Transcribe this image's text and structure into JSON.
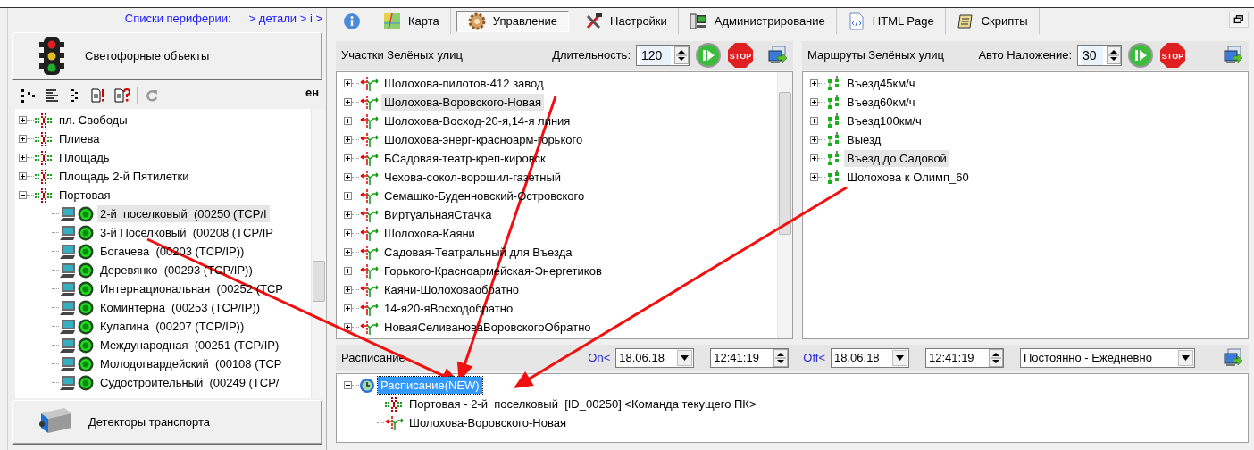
{
  "peripheral_links": [
    {
      "label": "Списки периферии:"
    },
    {
      "label": "> детали > i >"
    }
  ],
  "traffic_lights_button": {
    "label": "Светофорные объекты"
  },
  "left_toolbar": {
    "cut_label": "ен"
  },
  "object_tree": [
    {
      "kind": "intersection",
      "label": "пл. Свободы",
      "expanded": false,
      "selected": false
    },
    {
      "kind": "intersection",
      "label": "Плиева",
      "expanded": false,
      "selected": false
    },
    {
      "kind": "intersection",
      "label": "Площадь",
      "expanded": false,
      "selected": false
    },
    {
      "kind": "intersection",
      "label": "Площадь 2-й Пятилетки",
      "expanded": false,
      "selected": false
    },
    {
      "kind": "intersection",
      "label": "Портовая",
      "expanded": true,
      "selected": false,
      "children": [
        {
          "kind": "controller",
          "label": "2-й  поселковый  (00250 (TCP/I",
          "selected": true
        },
        {
          "kind": "controller",
          "label": "3-й Поселковый  (00208 (TCP/IP",
          "selected": false
        },
        {
          "kind": "controller",
          "label": "Богачева  (00203 (TCP/IP))",
          "selected": false
        },
        {
          "kind": "controller",
          "label": "Деревянко  (00293 (TCP/IP))",
          "selected": false
        },
        {
          "kind": "controller",
          "label": "Интернациональная  (00252 (TCP",
          "selected": false
        },
        {
          "kind": "controller",
          "label": "Коминтерна  (00253 (TCP/IP))",
          "selected": false
        },
        {
          "kind": "controller",
          "label": "Кулагина  (00207 (TCP/IP))",
          "selected": false
        },
        {
          "kind": "controller",
          "label": "Международная  (00251 (TCP/IP)",
          "selected": false
        },
        {
          "kind": "controller",
          "label": "Молодогвардейский  (00108 (TCP",
          "selected": false
        },
        {
          "kind": "controller",
          "label": "Судостроительный  (00249 (TCP/",
          "selected": false
        }
      ]
    }
  ],
  "detectors_button": {
    "label": "Детекторы транспорта"
  },
  "tabs": [
    {
      "kind": "info",
      "selected": false
    },
    {
      "kind": "map",
      "label": "Карта",
      "selected": false
    },
    {
      "kind": "gear",
      "label": "Управление",
      "selected": true
    },
    {
      "kind": "tools",
      "label": "Настройки",
      "selected": false
    },
    {
      "kind": "admin",
      "label": "Администрирование",
      "selected": false
    },
    {
      "kind": "html",
      "label": "HTML Page",
      "selected": false
    },
    {
      "kind": "script",
      "label": "Скрипты",
      "selected": false
    }
  ],
  "sections_panel": {
    "title": "Участки Зелёных улиц",
    "duration_label": "Длительность:",
    "duration": "120",
    "stop_label": "STOP",
    "items": [
      {
        "label": "Шолохова-пилотов-412 завод",
        "expanded": false,
        "selected": false
      },
      {
        "label": "Шолохова-Воровского-Новая",
        "expanded": false,
        "selected": true
      },
      {
        "label": "Шолохова-Восход-20-я,14-я линия",
        "expanded": false,
        "selected": false
      },
      {
        "label": "Шолохова-энерг-красноарм-горького",
        "expanded": false,
        "selected": false
      },
      {
        "label": "БСадовая-театр-креп-кировск",
        "expanded": false,
        "selected": false
      },
      {
        "label": "Чехова-сокол-ворошил-газетный",
        "expanded": false,
        "selected": false
      },
      {
        "label": "Семашко-Буденновский-Островского",
        "expanded": false,
        "selected": false
      },
      {
        "label": "ВиртуальнаяСтачка",
        "expanded": false,
        "selected": false
      },
      {
        "label": "Шолохова-Каяни",
        "expanded": false,
        "selected": false
      },
      {
        "label": "Садовая-Театральный для Въезда",
        "expanded": false,
        "selected": false
      },
      {
        "label": "Горького-Красноармейская-Энергетиков",
        "expanded": false,
        "selected": false
      },
      {
        "label": "Каяни-Шолоховаобратно",
        "expanded": false,
        "selected": false
      },
      {
        "label": "14-я20-яВосходобратно",
        "expanded": false,
        "selected": false
      },
      {
        "label": "НоваяСеливановаВоровскогоОбратно",
        "expanded": false,
        "selected": false
      }
    ]
  },
  "routes_panel": {
    "title": "Маршруты Зелёных улиц",
    "overlay_label": "Авто Наложение:",
    "overlay": "30",
    "stop_label": "STOP",
    "items": [
      {
        "label": "Въезд45км/ч",
        "expanded": false,
        "selected": false
      },
      {
        "label": "Въезд60км/ч",
        "expanded": false,
        "selected": false
      },
      {
        "label": "Въезд100км/ч",
        "expanded": false,
        "selected": false
      },
      {
        "label": "Выезд",
        "expanded": false,
        "selected": false
      },
      {
        "label": "Въезд до Садовой",
        "expanded": false,
        "selected": true
      },
      {
        "label": "Шолохова к Олимп_60",
        "expanded": false,
        "selected": false
      }
    ]
  },
  "schedule": {
    "title": "Расписание",
    "on_label": "On<",
    "on_date": "18.06.18",
    "on_time": "12:41:19",
    "off_label": "Off<",
    "off_date": "18.06.18",
    "off_time": "12:41:19",
    "mode": "Постоянно - Ежедневно",
    "tree": [
      {
        "kind": "schedule",
        "label": "Расписание(NEW)",
        "expanded": true,
        "selected": true,
        "children": [
          {
            "kind": "intersection",
            "label": "Портовая - 2-й  поселковый  [ID_00250] <Команда текущего ПК>",
            "selected": false
          },
          {
            "kind": "section",
            "label": "Шолохова-Воровского-Новая",
            "selected": false
          }
        ]
      }
    ]
  }
}
